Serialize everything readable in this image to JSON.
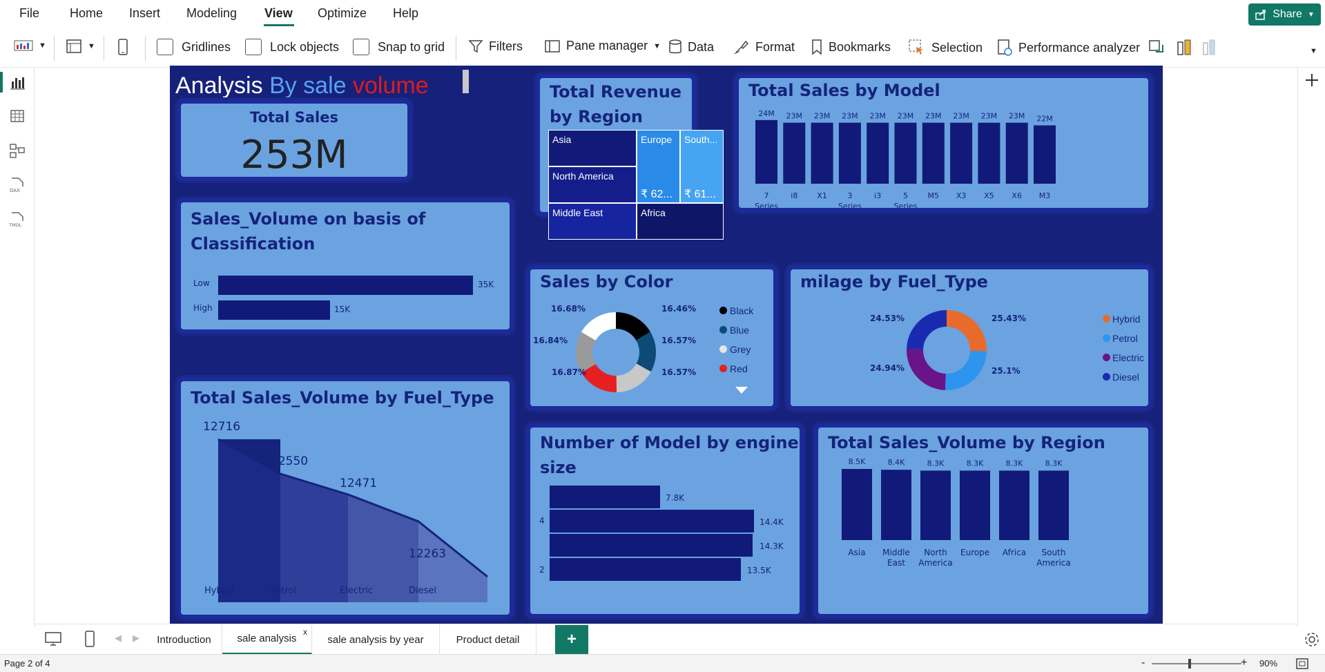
{
  "menu": [
    "File",
    "Home",
    "Insert",
    "Modeling",
    "View",
    "Optimize",
    "Help"
  ],
  "share_label": "Share",
  "toolbar": {
    "gridlines": "Gridlines",
    "lock": "Lock objects",
    "snap": "Snap to grid",
    "filters": "Filters",
    "pane_manager": "Pane manager",
    "data": "Data",
    "format": "Format",
    "bookmarks": "Bookmarks",
    "selection": "Selection",
    "perf": "Performance analyzer"
  },
  "report": {
    "title_part1": "Analysis",
    "title_part2": "By sale",
    "title_part3": "volume",
    "kpi_title": "Total Sales",
    "kpi_value": "253M"
  },
  "colors": {
    "canvas": "#16217b",
    "card": "#6aa3e0",
    "bar": "#111a78",
    "accent": "#117865"
  },
  "charts": {
    "classification": {
      "title": "Sales_Volume on basis of Classification",
      "categories": [
        "Low",
        "High"
      ],
      "labels": [
        "35K",
        "15K"
      ]
    },
    "fuel_line": {
      "title": "Total Sales_Volume by Fuel_Type",
      "categories": [
        "Hybrid",
        "Petrol",
        "Electric",
        "Diesel"
      ],
      "labels": [
        "12716",
        "12550",
        "12471",
        "12263"
      ]
    },
    "revenue_region": {
      "title": "Total Revenue by Region",
      "cells": [
        "Asia",
        "Europe",
        "South...",
        "North America",
        "₹ 62...",
        "₹ 61...",
        "Middle East",
        "Africa"
      ]
    },
    "model": {
      "title": "Total Sales by Model",
      "labels": [
        "24M",
        "23M",
        "23M",
        "23M",
        "23M",
        "23M",
        "23M",
        "23M",
        "23M",
        "23M",
        "22M"
      ],
      "categories": [
        "7 Series",
        "i8",
        "X1",
        "3 Series",
        "i3",
        "5 Series",
        "M5",
        "X3",
        "X5",
        "X6",
        "M3"
      ]
    },
    "color": {
      "title": "Sales by Color",
      "legend": [
        "Black",
        "Blue",
        "Grey",
        "Red"
      ],
      "labels": [
        "16.68%",
        "16.46%",
        "16.84%",
        "16.57%",
        "16.87%",
        "16.57%"
      ]
    },
    "mileage": {
      "title": "milage by Fuel_Type",
      "legend": [
        "Hybrid",
        "Petrol",
        "Electric",
        "Diesel"
      ],
      "labels": [
        "24.53%",
        "25.43%",
        "24.94%",
        "25.1%"
      ]
    },
    "engine": {
      "title": "Number of Model by engine size",
      "axis": [
        "4",
        "2"
      ],
      "labels": [
        "7.8K",
        "14.4K",
        "14.3K",
        "13.5K"
      ]
    },
    "region_volume": {
      "title": "Total Sales_Volume by Region",
      "labels": [
        "8.5K",
        "8.4K",
        "8.3K",
        "8.3K",
        "8.3K",
        "8.3K"
      ],
      "categories": [
        "Asia",
        "Middle East",
        "North America",
        "Europe",
        "Africa",
        "South America"
      ]
    }
  },
  "chart_data": [
    {
      "type": "bar",
      "title": "Sales_Volume on basis of Classification",
      "categories": [
        "Low",
        "High"
      ],
      "values": [
        35000,
        15000
      ]
    },
    {
      "type": "area",
      "title": "Total Sales_Volume by Fuel_Type",
      "categories": [
        "Hybrid",
        "Petrol",
        "Electric",
        "Diesel"
      ],
      "values": [
        12716,
        12550,
        12471,
        12263
      ]
    },
    {
      "type": "bar",
      "title": "Total Sales by Model",
      "categories": [
        "7 Series",
        "i8",
        "X1",
        "3 Series",
        "i3",
        "5 Series",
        "M5",
        "X3",
        "X5",
        "X6",
        "M3"
      ],
      "values": [
        24000000,
        23000000,
        23000000,
        23000000,
        23000000,
        23000000,
        23000000,
        23000000,
        23000000,
        23000000,
        22000000
      ]
    },
    {
      "type": "pie",
      "title": "Sales by Color",
      "series": [
        {
          "name": "Black",
          "values": [
            16.46
          ]
        },
        {
          "name": "Blue",
          "values": [
            16.57
          ]
        },
        {
          "name": "Grey",
          "values": [
            16.57
          ]
        },
        {
          "name": "Red",
          "values": [
            16.87
          ]
        }
      ]
    },
    {
      "type": "pie",
      "title": "milage by Fuel_Type",
      "series": [
        {
          "name": "Hybrid",
          "values": [
            25.43
          ]
        },
        {
          "name": "Petrol",
          "values": [
            25.1
          ]
        },
        {
          "name": "Electric",
          "values": [
            24.94
          ]
        },
        {
          "name": "Diesel",
          "values": [
            24.53
          ]
        }
      ]
    },
    {
      "type": "bar",
      "title": "Number of Model by engine size",
      "categories": [
        "",
        "4",
        "",
        "2"
      ],
      "values": [
        7800,
        14400,
        14300,
        13500
      ]
    },
    {
      "type": "bar",
      "title": "Total Sales_Volume by Region",
      "categories": [
        "Asia",
        "Middle East",
        "North America",
        "Europe",
        "Africa",
        "South America"
      ],
      "values": [
        8500,
        8400,
        8300,
        8300,
        8300,
        8300
      ]
    }
  ],
  "tabs": [
    "Introduction",
    "sale analysis",
    "sale analysis by year",
    "Product detail"
  ],
  "tab_close": "x",
  "add_tab": "+",
  "status": {
    "page": "Page 2 of 4",
    "zoom": "90%"
  }
}
